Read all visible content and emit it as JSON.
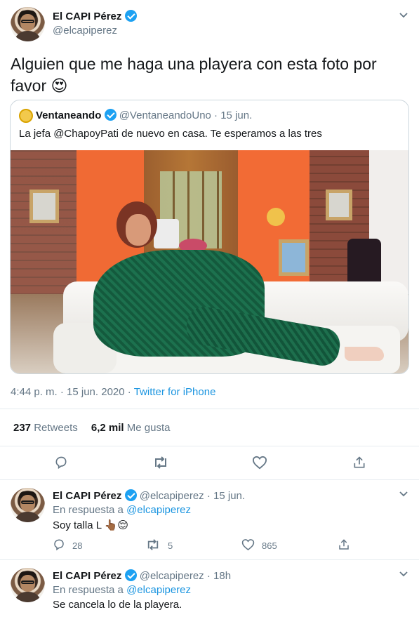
{
  "main_tweet": {
    "author": {
      "name": "El CAPI Pérez",
      "handle": "@elcapiperez"
    },
    "text": "Alguien que me haga una playera con esta foto por favor 😍",
    "quoted_tweet": {
      "author_name": "Ventaneando",
      "author_handle": "@VentaneandoUno",
      "date": "· 15 jun.",
      "text": "La jefa @ChapoyPati de nuevo en casa. Te esperamos a las tres"
    },
    "meta": {
      "time_date": "4:44 p. m. · 15 jun. 2020 ·",
      "source": "Twitter for iPhone"
    },
    "stats": {
      "retweets_count": "237",
      "retweets_label": "Retweets",
      "likes_count": "6,2 mil",
      "likes_label": "Me gusta"
    }
  },
  "replies": [
    {
      "name": "El CAPI Pérez",
      "handle": "@elcapiperez",
      "time": "· 15 jun.",
      "reply_to_prefix": "En respuesta a",
      "reply_to_handle": "@elcapiperez",
      "text": "Soy talla L",
      "emoji_text": "👆🏾😌",
      "actions": {
        "replies": "28",
        "retweets": "5",
        "likes": "865"
      }
    },
    {
      "name": "El CAPI Pérez",
      "handle": "@elcapiperez",
      "time": "· 18h",
      "reply_to_prefix": "En respuesta a",
      "reply_to_handle": "@elcapiperez",
      "text": "Se cancela lo de la playera."
    }
  ],
  "colors": {
    "accent_blue": "#1da1f2",
    "link_blue": "#1b95e0",
    "muted_gray": "#657786",
    "border_gray": "#e6ecf0"
  },
  "icons": {
    "verified": "verified-badge-icon",
    "more": "chevron-down-icon",
    "reply": "reply-icon",
    "retweet": "retweet-icon",
    "like": "heart-icon",
    "share": "share-icon"
  }
}
